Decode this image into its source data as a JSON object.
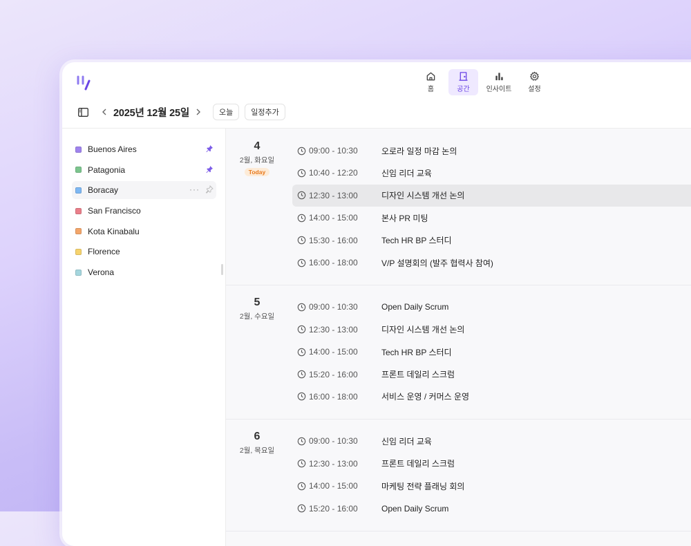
{
  "nav": {
    "items": [
      {
        "label": "홈",
        "icon": "home-icon",
        "active": false
      },
      {
        "label": "공간",
        "icon": "door-icon",
        "active": true
      },
      {
        "label": "인사이트",
        "icon": "bar-chart-icon",
        "active": false
      },
      {
        "label": "설정",
        "icon": "gear-icon",
        "active": false
      }
    ]
  },
  "toolbar": {
    "date_title": "2025년 12월 25일",
    "today_label": "오늘",
    "add_event_label": "일정추가"
  },
  "sidebar": {
    "spaces": [
      {
        "name": "Buenos Aires",
        "color": "#a084ee",
        "pinned": true
      },
      {
        "name": "Patagonia",
        "color": "#7cc58e",
        "pinned": true
      },
      {
        "name": "Boracay",
        "color": "#7eb8f3",
        "pinned": false,
        "hover": true
      },
      {
        "name": "San Francisco",
        "color": "#ea7f8a",
        "pinned": false
      },
      {
        "name": "Kota Kinabalu",
        "color": "#f3a66a",
        "pinned": false
      },
      {
        "name": "Florence",
        "color": "#f6d36e",
        "pinned": false
      },
      {
        "name": "Verona",
        "color": "#a5d6de",
        "pinned": false
      }
    ]
  },
  "days": [
    {
      "num": "4",
      "sub": "2월, 화요일",
      "badge": "Today",
      "events": [
        {
          "time": "09:00 - 10:30",
          "title": "오로라 일정 마감 논의"
        },
        {
          "time": "10:40 - 12:20",
          "title": "신임 리더 교육"
        },
        {
          "time": "12:30 - 13:00",
          "title": "디자인 시스템 개선 논의",
          "highlight": true
        },
        {
          "time": "14:00 - 15:00",
          "title": "본사 PR 미팅"
        },
        {
          "time": "15:30 - 16:00",
          "title": "Tech HR BP 스터디"
        },
        {
          "time": "16:00 - 18:00",
          "title": "V/P 설명회의 (발주 협력사 참여)"
        }
      ]
    },
    {
      "num": "5",
      "sub": "2월, 수요일",
      "events": [
        {
          "time": "09:00 - 10:30",
          "title": "Open Daily Scrum"
        },
        {
          "time": "12:30 - 13:00",
          "title": "디자인 시스템 개선 논의"
        },
        {
          "time": "14:00 - 15:00",
          "title": "Tech HR BP 스터디"
        },
        {
          "time": "15:20 - 16:00",
          "title": "프론트 데일리 스크럼"
        },
        {
          "time": "16:00 - 18:00",
          "title": "서비스 운영 / 커머스 운영"
        }
      ]
    },
    {
      "num": "6",
      "sub": "2월, 목요일",
      "events": [
        {
          "time": "09:00 - 10:30",
          "title": "신임 리더 교육"
        },
        {
          "time": "12:30 - 13:00",
          "title": "프론트 데일리 스크럼"
        },
        {
          "time": "14:00 - 15:00",
          "title": "마케팅 전략 플래닝 회의"
        },
        {
          "time": "15:20 - 16:00",
          "title": "Open Daily Scrum"
        }
      ]
    }
  ]
}
